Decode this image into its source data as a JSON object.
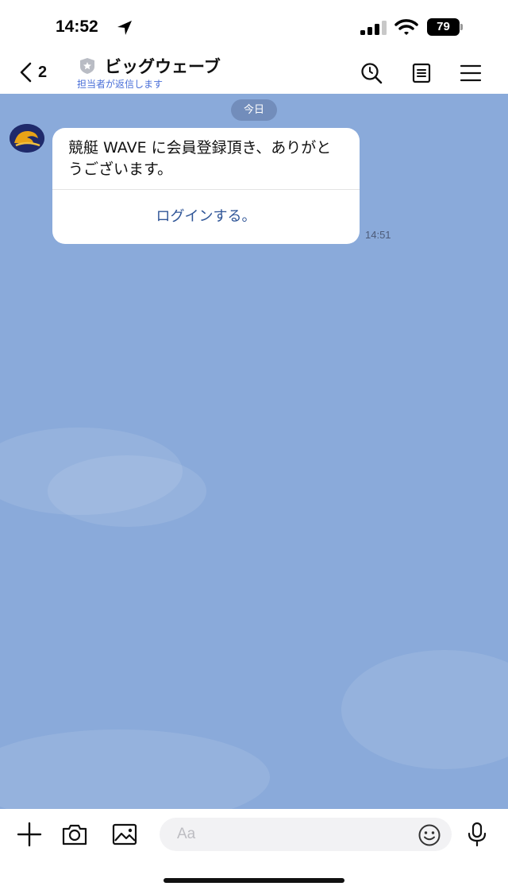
{
  "status_bar": {
    "time": "14:52",
    "battery": "79"
  },
  "header": {
    "back_count": "2",
    "title": "ビッグウェーブ",
    "subtitle": "担当者が返信します",
    "icons": [
      "search-icon",
      "notes-icon",
      "menu-icon"
    ]
  },
  "chat": {
    "date_label": "今日",
    "messages": [
      {
        "text": "競艇 WAVE に会員登録頂き、ありがとうございます。",
        "action_label": "ログインする。",
        "time": "14:51"
      }
    ]
  },
  "input_bar": {
    "placeholder": "Aa",
    "icons": [
      "plus-icon",
      "camera-icon",
      "image-icon",
      "emoji-icon",
      "microphone-icon"
    ]
  },
  "colors": {
    "chat_background": "#8aaada",
    "link": "#2f5597",
    "subtitle": "#4a6fd8"
  }
}
